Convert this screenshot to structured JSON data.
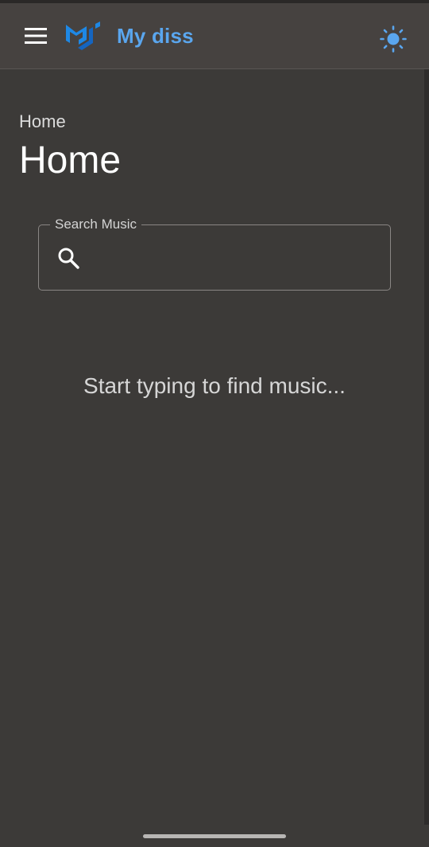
{
  "app": {
    "title": "My diss",
    "accent_color": "#5aa6ee",
    "logo_color": "#1e88e5"
  },
  "icons": {
    "menu": "menu-icon",
    "logo": "mui-logo-icon",
    "theme": "sun-icon",
    "search": "search-icon"
  },
  "page": {
    "breadcrumb": "Home",
    "title": "Home"
  },
  "search": {
    "label": "Search Music",
    "value": ""
  },
  "empty_state": {
    "message": "Start typing to find music..."
  }
}
